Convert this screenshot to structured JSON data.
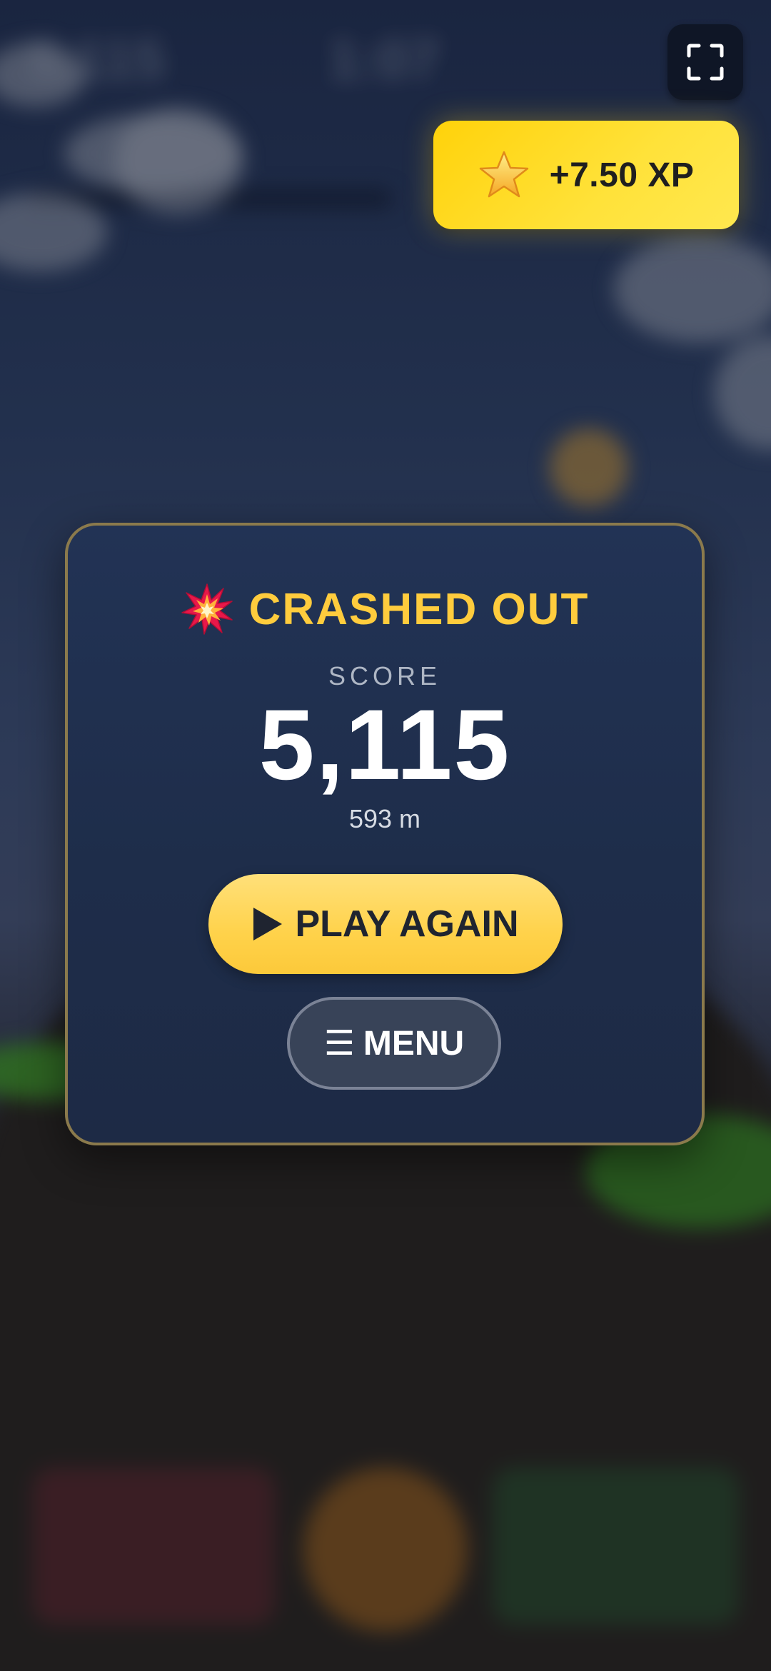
{
  "hud": {
    "score_ghost": "5,115",
    "distance_ghost": "1:07"
  },
  "fullscreen": {
    "icon": "fullscreen-icon"
  },
  "xp_badge": {
    "icon": "star-icon",
    "text": "+7.50 XP"
  },
  "result_card": {
    "icon": "collision-icon",
    "title": "CRASHED OUT",
    "score_label": "SCORE",
    "score_value": "5,115",
    "distance": "593 m",
    "play_again_label": "PLAY AGAIN",
    "play_again_icon": "play-icon",
    "menu_label": "MENU",
    "menu_icon": "☰"
  },
  "colors": {
    "title": "#ffcc3d",
    "xp_badge": "#ffd20a",
    "card_border": "#8b7a4c",
    "card_bg": "#1e2d4a",
    "play_button": "#ffd24a",
    "menu_button": "#384358"
  }
}
